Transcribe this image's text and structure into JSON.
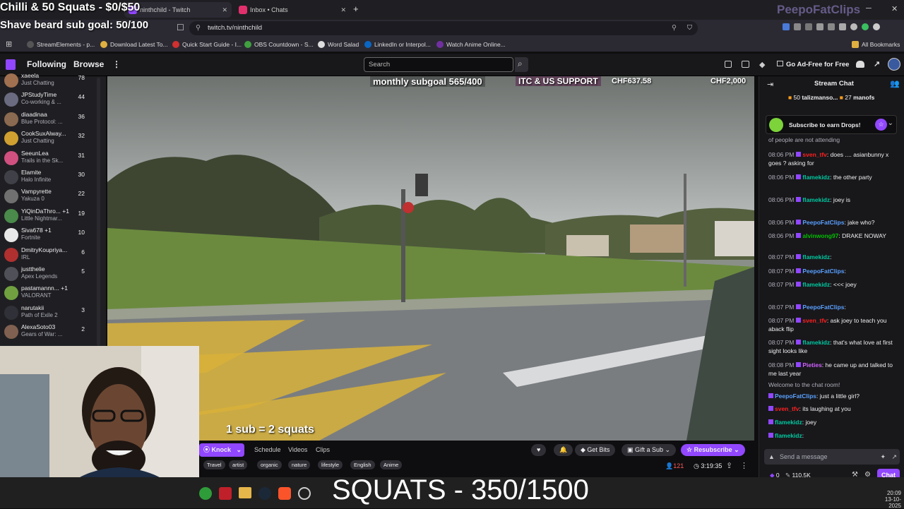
{
  "overlay": {
    "title": "Chilli & 50 Squats - $0/$50",
    "goal": "Shave beard sub goal: 50/100",
    "watermark": "PeepoFatClips",
    "monthly_subgoal": "monthly subgoal 565/400",
    "itc_support": "ITC & US SUPPORT",
    "chf_left": "CHF637.58",
    "chf_right": "CHF2,000",
    "sub_squats": "1 sub = 2 squats",
    "squats_counter": "SQUATS - 350/1500"
  },
  "browser": {
    "tabs": [
      {
        "label": "ninthchild - Twitch",
        "icon": "twitch-icon",
        "color": "#9147ff"
      },
      {
        "label": "Inbox • Chats",
        "icon": "instagram-icon",
        "color": "#e1306c"
      }
    ],
    "url": "twitch.tv/ninthchild",
    "bookmarks": [
      {
        "label": "StreamElements - p...",
        "color": "#555"
      },
      {
        "label": "Download Latest To...",
        "color": "#e0b040"
      },
      {
        "label": "Quick Start Guide - I...",
        "color": "#d03030"
      },
      {
        "label": "OBS Countdown - S...",
        "color": "#40a040"
      },
      {
        "label": "Word Salad",
        "color": "#dddddd"
      },
      {
        "label": "LinkedIn or Interpol...",
        "color": "#0a66c2"
      },
      {
        "label": "Watch Anime Online...",
        "color": "#7030a0"
      }
    ],
    "all_bookmarks": "All Bookmarks"
  },
  "twitch_nav": {
    "following": "Following",
    "browse": "Browse",
    "search_placeholder": "Search",
    "ad_free": "Go Ad-Free for Free"
  },
  "sidebar": {
    "channels": [
      {
        "name": "xaeela",
        "game": "Just Chatting",
        "viewers": "78",
        "color": "#a07050"
      },
      {
        "name": "JPStudyTime",
        "game": "Co-working & ...",
        "viewers": "44",
        "color": "#6a6a80"
      },
      {
        "name": "diaadinaa",
        "game": "Blue Protocol: ...",
        "viewers": "36",
        "color": "#8a6a50"
      },
      {
        "name": "CookSuxAlway...",
        "game": "Just Chatting",
        "viewers": "32",
        "color": "#d0a030"
      },
      {
        "name": "SeeunLea",
        "game": "Trails in the Sk...",
        "viewers": "31",
        "color": "#d05080"
      },
      {
        "name": "Elamite",
        "game": "Halo Infinite",
        "viewers": "30",
        "color": "#404048"
      },
      {
        "name": "Vampyrette",
        "game": "Yakuza 0",
        "viewers": "22",
        "color": "#707070"
      },
      {
        "name": "YiQinDaThro... +1",
        "game": "Little Nightmar...",
        "viewers": "19",
        "color": "#4a8a4a"
      },
      {
        "name": "Siva678 +1",
        "game": "Fortnite",
        "viewers": "10",
        "color": "#e8e8e8"
      },
      {
        "name": "DmitryKoupriya...",
        "game": "IRL",
        "viewers": "6",
        "color": "#b03030"
      },
      {
        "name": "justthelie",
        "game": "Apex Legends",
        "viewers": "5",
        "color": "#505058"
      },
      {
        "name": "pastamannn... +1",
        "game": "VALORANT",
        "viewers": "",
        "color": "#70a040"
      },
      {
        "name": "narutakii",
        "game": "Path of Exile 2",
        "viewers": "3",
        "color": "#303038"
      },
      {
        "name": "AlexaSoto03",
        "game": "Gears of War: ...",
        "viewers": "2",
        "color": "#806050"
      }
    ]
  },
  "channel_bar": {
    "knock": "Knock",
    "schedule": "Schedule",
    "videos": "Videos",
    "clips": "Clips",
    "get_bits": "Get Bits",
    "gift_sub": "Gift a Sub",
    "resubscribe": "Resubscribe",
    "tags": [
      "Travel",
      "artist",
      "organic",
      "nature",
      "lifestyle",
      "English",
      "Anime"
    ],
    "viewers": "121",
    "uptime": "3:19:35"
  },
  "chat": {
    "header": "Stream Chat",
    "gift_row": {
      "a_count": "50",
      "a_name": "talizmanso...",
      "b_count": "27",
      "b_name": "manofs"
    },
    "drops": "Subscribe to earn Drops!",
    "messages": [
      {
        "time": "",
        "user": "",
        "color": "#adadb8",
        "text": "of people are not attending"
      },
      {
        "time": "08:06 PM",
        "user": "sven_tfv",
        "color": "#ff2020",
        "text": ": does .... asianbunny x goes ? asking for"
      },
      {
        "time": "08:06 PM",
        "user": "flamekidz",
        "color": "#00c8a0",
        "text": ": the other party"
      },
      {
        "time": "08:06 PM",
        "user": "flamekidz",
        "color": "#00c8a0",
        "text": ": joey is"
      },
      {
        "time": "08:06 PM",
        "user": "PeepoFatClips",
        "color": "#5aa0ff",
        "text": ": jake who?"
      },
      {
        "time": "08:06 PM",
        "user": "alvinwong97",
        "color": "#00c000",
        "text": ": DRAKE NOWAY"
      },
      {
        "time": "08:07 PM",
        "user": "flamekidz",
        "color": "#00c8a0",
        "text": ":"
      },
      {
        "time": "08:07 PM",
        "user": "PeepoFatClips",
        "color": "#5aa0ff",
        "text": ":"
      },
      {
        "time": "08:07 PM",
        "user": "flamekidz",
        "color": "#00c8a0",
        "text": ": <<< joey"
      },
      {
        "time": "08:07 PM",
        "user": "PeepoFatClips",
        "color": "#5aa0ff",
        "text": ":"
      },
      {
        "time": "08:07 PM",
        "user": "sven_tfv",
        "color": "#ff2020",
        "text": ": ask joey to teach you aback flip"
      },
      {
        "time": "08:07 PM",
        "user": "flamekidz",
        "color": "#00c8a0",
        "text": ": that's what love at first sight looks like"
      },
      {
        "time": "08:08 PM",
        "user": "Pieties",
        "color": "#d060ff",
        "text": ": he came up and talked to me last year"
      },
      {
        "time": "",
        "user": "",
        "color": "#adadb8",
        "text": "Welcome to the chat room!"
      },
      {
        "time": "",
        "user": "PeepoFatClips",
        "color": "#5aa0ff",
        "text": ": just a little girl?"
      },
      {
        "time": "",
        "user": "sven_tfv",
        "color": "#ff2020",
        "text": ": its laughing at you"
      },
      {
        "time": "",
        "user": "flamekidz",
        "color": "#00c8a0",
        "text": ":  joey"
      },
      {
        "time": "",
        "user": "flamekidz",
        "color": "#00c8a0",
        "text": ":"
      }
    ],
    "input_placeholder": "Send a message",
    "points_a": "0",
    "points_b": "110.5K",
    "send": "Chat"
  },
  "taskbar": {
    "time": "20:09",
    "date": "13-10-2025"
  }
}
